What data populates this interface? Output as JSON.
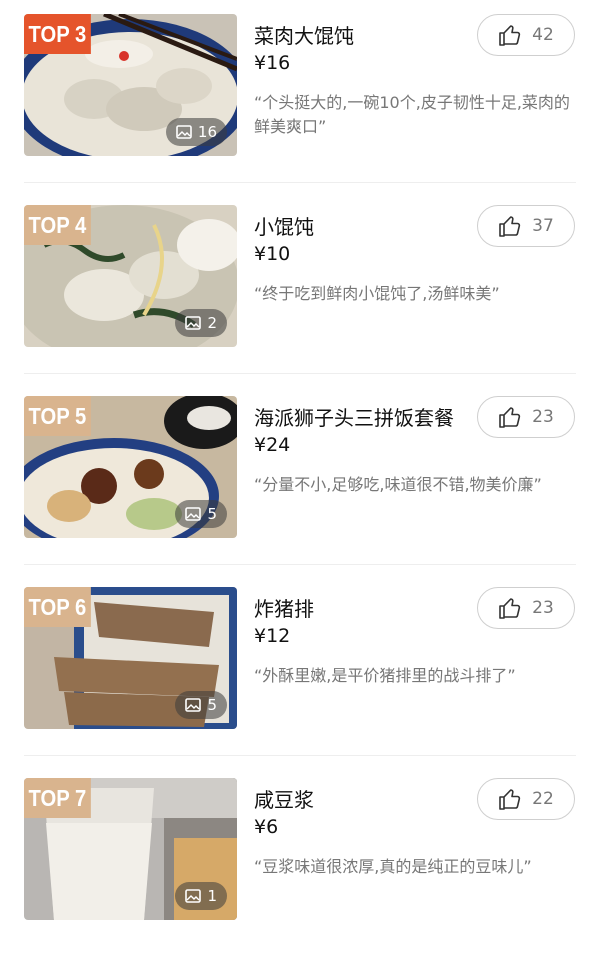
{
  "items": [
    {
      "rank": "TOP 3",
      "title": "菜肉大馄饨",
      "price": "¥16",
      "quote": "“个头挺大的,一碗10个,皮子韧性十足,菜肉的鲜美爽口”",
      "likes": "42",
      "photos": "16",
      "rank_color": "#e5542b"
    },
    {
      "rank": "TOP 4",
      "title": "小馄饨",
      "price": "¥10",
      "quote": "“终于吃到鲜肉小馄饨了,汤鲜味美”",
      "likes": "37",
      "photos": "2",
      "rank_color": "#d9b48e"
    },
    {
      "rank": "TOP 5",
      "title": "海派狮子头三拼饭套餐",
      "price": "¥24",
      "quote": "“分量不小,足够吃,味道很不错,物美价廉”",
      "likes": "23",
      "photos": "5",
      "rank_color": "#d9b48e"
    },
    {
      "rank": "TOP 6",
      "title": "炸猪排",
      "price": "¥12",
      "quote": "“外酥里嫩,是平价猪排里的战斗排了”",
      "likes": "23",
      "photos": "5",
      "rank_color": "#d9b48e"
    },
    {
      "rank": "TOP 7",
      "title": "咸豆浆",
      "price": "¥6",
      "quote": "“豆浆味道很浓厚,真的是纯正的豆味儿”",
      "likes": "22",
      "photos": "1",
      "rank_color": "#d9b48e"
    }
  ],
  "icons": {
    "like": "thumbs-up-icon",
    "photo": "image-icon"
  }
}
